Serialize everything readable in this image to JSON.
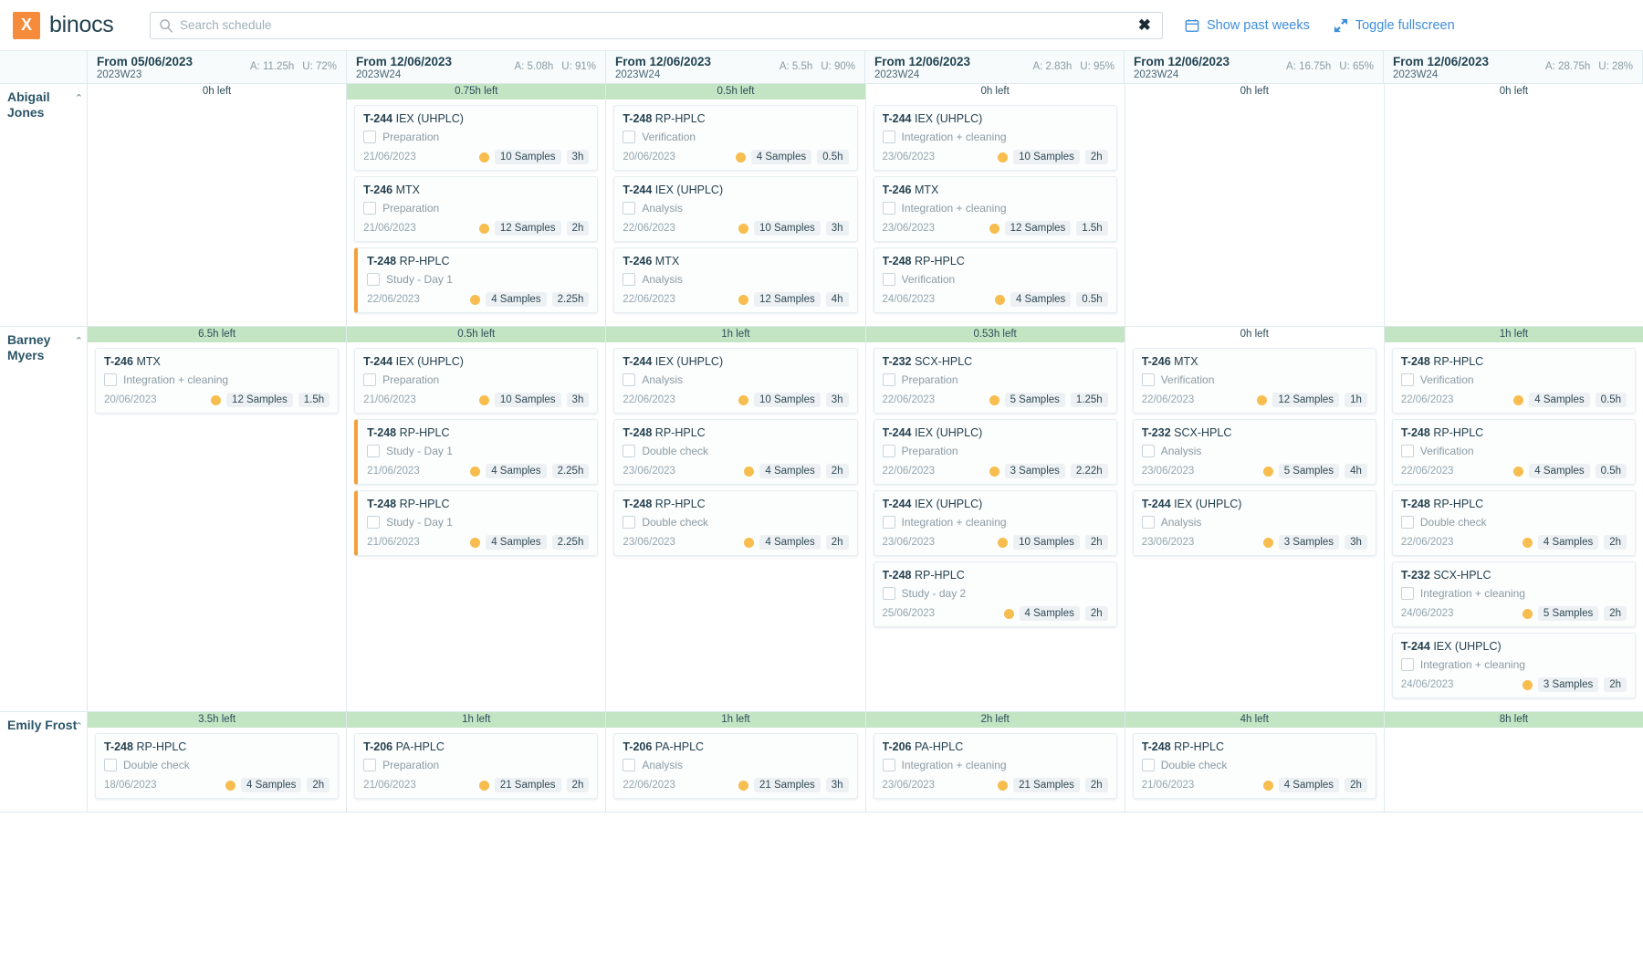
{
  "app": {
    "brand_initial": "X",
    "brand_name": "binocs"
  },
  "search": {
    "placeholder": "Search schedule",
    "value": "",
    "clear_glyph": "✖"
  },
  "toolbar": {
    "show_past_weeks": "Show past weeks",
    "toggle_fullscreen": "Toggle fullscreen"
  },
  "columns": [
    {
      "date": "From 05/06/2023",
      "week": "2023W23",
      "a": "A: 11.25h",
      "u": "U: 72%"
    },
    {
      "date": "From 12/06/2023",
      "week": "2023W24",
      "a": "A: 5.08h",
      "u": "U: 91%"
    },
    {
      "date": "From 12/06/2023",
      "week": "2023W24",
      "a": "A: 5.5h",
      "u": "U: 90%"
    },
    {
      "date": "From 12/06/2023",
      "week": "2023W24",
      "a": "A: 2.83h",
      "u": "U: 95%"
    },
    {
      "date": "From 12/06/2023",
      "week": "2023W24",
      "a": "A: 16.75h",
      "u": "U: 65%"
    },
    {
      "date": "From 12/06/2023",
      "week": "2023W24",
      "a": "A: 28.75h",
      "u": "U: 28%"
    }
  ],
  "people": [
    {
      "name": "Abigail Jones",
      "collapse_glyph": "⌃",
      "cells": [
        {
          "left": "0h left",
          "green": false,
          "cards": []
        },
        {
          "left": "0.75h left",
          "green": true,
          "cards": [
            {
              "code": "T-244",
              "assay": "IEX (UHPLC)",
              "step": "Preparation",
              "date": "21/06/2023",
              "samples": "10 Samples",
              "duration": "3h",
              "flag": false
            },
            {
              "code": "T-246",
              "assay": "MTX",
              "step": "Preparation",
              "date": "21/06/2023",
              "samples": "12 Samples",
              "duration": "2h",
              "flag": false
            },
            {
              "code": "T-248",
              "assay": "RP-HPLC",
              "step": "Study - Day 1",
              "date": "22/06/2023",
              "samples": "4 Samples",
              "duration": "2.25h",
              "flag": true
            }
          ]
        },
        {
          "left": "0.5h left",
          "green": true,
          "cards": [
            {
              "code": "T-248",
              "assay": "RP-HPLC",
              "step": "Verification",
              "date": "20/06/2023",
              "samples": "4 Samples",
              "duration": "0.5h",
              "flag": false
            },
            {
              "code": "T-244",
              "assay": "IEX (UHPLC)",
              "step": "Analysis",
              "date": "22/06/2023",
              "samples": "10 Samples",
              "duration": "3h",
              "flag": false
            },
            {
              "code": "T-246",
              "assay": "MTX",
              "step": "Analysis",
              "date": "22/06/2023",
              "samples": "12 Samples",
              "duration": "4h",
              "flag": false
            }
          ]
        },
        {
          "left": "0h left",
          "green": false,
          "cards": [
            {
              "code": "T-244",
              "assay": "IEX (UHPLC)",
              "step": "Integration + cleaning",
              "date": "23/06/2023",
              "samples": "10 Samples",
              "duration": "2h",
              "flag": false
            },
            {
              "code": "T-246",
              "assay": "MTX",
              "step": "Integration + cleaning",
              "date": "23/06/2023",
              "samples": "12 Samples",
              "duration": "1.5h",
              "flag": false
            },
            {
              "code": "T-248",
              "assay": "RP-HPLC",
              "step": "Verification",
              "date": "24/06/2023",
              "samples": "4 Samples",
              "duration": "0.5h",
              "flag": false
            }
          ]
        },
        {
          "left": "0h left",
          "green": false,
          "cards": []
        },
        {
          "left": "0h left",
          "green": false,
          "cards": []
        }
      ]
    },
    {
      "name": "Barney Myers",
      "collapse_glyph": "⌃",
      "cells": [
        {
          "left": "6.5h left",
          "green": true,
          "cards": [
            {
              "code": "T-246",
              "assay": "MTX",
              "step": "Integration + cleaning",
              "date": "20/06/2023",
              "samples": "12 Samples",
              "duration": "1.5h",
              "flag": false
            }
          ]
        },
        {
          "left": "0.5h left",
          "green": true,
          "cards": [
            {
              "code": "T-244",
              "assay": "IEX (UHPLC)",
              "step": "Preparation",
              "date": "21/06/2023",
              "samples": "10 Samples",
              "duration": "3h",
              "flag": false
            },
            {
              "code": "T-248",
              "assay": "RP-HPLC",
              "step": "Study - Day 1",
              "date": "21/06/2023",
              "samples": "4 Samples",
              "duration": "2.25h",
              "flag": true
            },
            {
              "code": "T-248",
              "assay": "RP-HPLC",
              "step": "Study - Day 1",
              "date": "21/06/2023",
              "samples": "4 Samples",
              "duration": "2.25h",
              "flag": true
            }
          ]
        },
        {
          "left": "1h left",
          "green": true,
          "cards": [
            {
              "code": "T-244",
              "assay": "IEX (UHPLC)",
              "step": "Analysis",
              "date": "22/06/2023",
              "samples": "10 Samples",
              "duration": "3h",
              "flag": false
            },
            {
              "code": "T-248",
              "assay": "RP-HPLC",
              "step": "Double check",
              "date": "23/06/2023",
              "samples": "4 Samples",
              "duration": "2h",
              "flag": false
            },
            {
              "code": "T-248",
              "assay": "RP-HPLC",
              "step": "Double check",
              "date": "23/06/2023",
              "samples": "4 Samples",
              "duration": "2h",
              "flag": false
            }
          ]
        },
        {
          "left": "0.53h left",
          "green": true,
          "cards": [
            {
              "code": "T-232",
              "assay": "SCX-HPLC",
              "step": "Preparation",
              "date": "22/06/2023",
              "samples": "5 Samples",
              "duration": "1.25h",
              "flag": false
            },
            {
              "code": "T-244",
              "assay": "IEX (UHPLC)",
              "step": "Preparation",
              "date": "22/06/2023",
              "samples": "3 Samples",
              "duration": "2.22h",
              "flag": false
            },
            {
              "code": "T-244",
              "assay": "IEX (UHPLC)",
              "step": "Integration + cleaning",
              "date": "23/06/2023",
              "samples": "10 Samples",
              "duration": "2h",
              "flag": false
            },
            {
              "code": "T-248",
              "assay": "RP-HPLC",
              "step": "Study - day 2",
              "date": "25/06/2023",
              "samples": "4 Samples",
              "duration": "2h",
              "flag": false
            }
          ]
        },
        {
          "left": "0h left",
          "green": false,
          "cards": [
            {
              "code": "T-246",
              "assay": "MTX",
              "step": "Verification",
              "date": "22/06/2023",
              "samples": "12 Samples",
              "duration": "1h",
              "flag": false
            },
            {
              "code": "T-232",
              "assay": "SCX-HPLC",
              "step": "Analysis",
              "date": "23/06/2023",
              "samples": "5 Samples",
              "duration": "4h",
              "flag": false
            },
            {
              "code": "T-244",
              "assay": "IEX (UHPLC)",
              "step": "Analysis",
              "date": "23/06/2023",
              "samples": "3 Samples",
              "duration": "3h",
              "flag": false
            }
          ]
        },
        {
          "left": "1h left",
          "green": true,
          "cards": [
            {
              "code": "T-248",
              "assay": "RP-HPLC",
              "step": "Verification",
              "date": "22/06/2023",
              "samples": "4 Samples",
              "duration": "0.5h",
              "flag": false
            },
            {
              "code": "T-248",
              "assay": "RP-HPLC",
              "step": "Verification",
              "date": "22/06/2023",
              "samples": "4 Samples",
              "duration": "0.5h",
              "flag": false
            },
            {
              "code": "T-248",
              "assay": "RP-HPLC",
              "step": "Double check",
              "date": "22/06/2023",
              "samples": "4 Samples",
              "duration": "2h",
              "flag": false
            },
            {
              "code": "T-232",
              "assay": "SCX-HPLC",
              "step": "Integration + cleaning",
              "date": "24/06/2023",
              "samples": "5 Samples",
              "duration": "2h",
              "flag": false
            },
            {
              "code": "T-244",
              "assay": "IEX (UHPLC)",
              "step": "Integration + cleaning",
              "date": "24/06/2023",
              "samples": "3 Samples",
              "duration": "2h",
              "flag": false
            }
          ]
        }
      ]
    },
    {
      "name": "Emily Frost",
      "collapse_glyph": "⌃",
      "cells": [
        {
          "left": "3.5h left",
          "green": true,
          "cards": [
            {
              "code": "T-248",
              "assay": "RP-HPLC",
              "step": "Double check",
              "date": "18/06/2023",
              "samples": "4 Samples",
              "duration": "2h",
              "flag": false
            }
          ]
        },
        {
          "left": "1h left",
          "green": true,
          "cards": [
            {
              "code": "T-206",
              "assay": "PA-HPLC",
              "step": "Preparation",
              "date": "21/06/2023",
              "samples": "21 Samples",
              "duration": "2h",
              "flag": false
            }
          ]
        },
        {
          "left": "1h left",
          "green": true,
          "cards": [
            {
              "code": "T-206",
              "assay": "PA-HPLC",
              "step": "Analysis",
              "date": "22/06/2023",
              "samples": "21 Samples",
              "duration": "3h",
              "flag": false
            }
          ]
        },
        {
          "left": "2h left",
          "green": true,
          "cards": [
            {
              "code": "T-206",
              "assay": "PA-HPLC",
              "step": "Integration + cleaning",
              "date": "23/06/2023",
              "samples": "21 Samples",
              "duration": "2h",
              "flag": false
            }
          ]
        },
        {
          "left": "4h left",
          "green": true,
          "cards": [
            {
              "code": "T-248",
              "assay": "RP-HPLC",
              "step": "Double check",
              "date": "21/06/2023",
              "samples": "4 Samples",
              "duration": "2h",
              "flag": false
            }
          ]
        },
        {
          "left": "8h left",
          "green": true,
          "cards": []
        }
      ]
    }
  ]
}
